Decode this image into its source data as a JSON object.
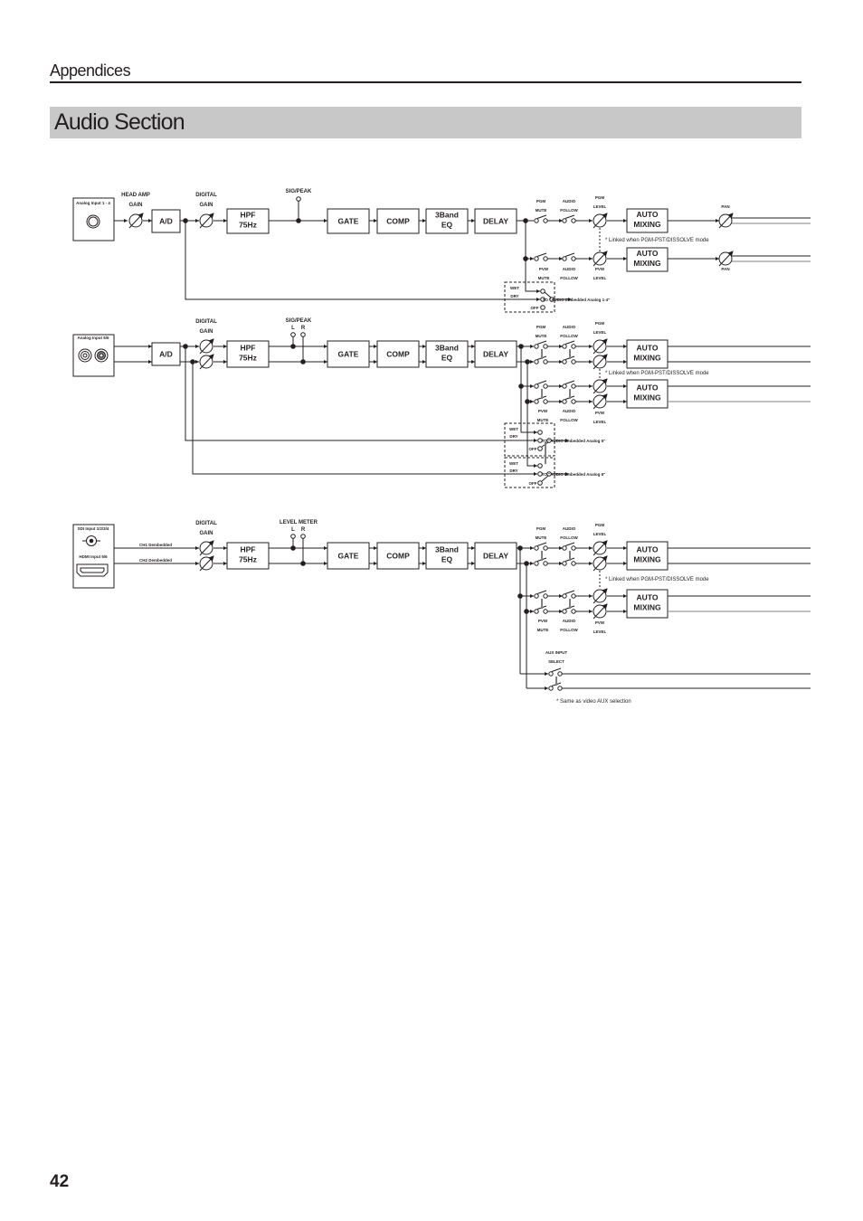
{
  "header": {
    "section": "Appendices",
    "title": "Audio Section"
  },
  "page_number": "42",
  "colors": {
    "ink": "#231f20",
    "title_bar": "#c8c8c8",
    "secondary_line": "#808080"
  },
  "labels": {
    "head_amp_gain": [
      "HEAD AMP",
      "GAIN"
    ],
    "digital_gain": [
      "DIGITAL",
      "GAIN"
    ],
    "sig_peak": "SIG/PEAK",
    "level_meter": "LEVEL METER",
    "l": "L",
    "r": "R",
    "pgm_mute": [
      "PGM",
      "MUTE"
    ],
    "pvw_mute": [
      "PVW",
      "MUTE"
    ],
    "audio_follow": [
      "AUDIO",
      "FOLLOW"
    ],
    "pgm_level": [
      "PGM",
      "LEVEL"
    ],
    "pvw_level": [
      "PVW",
      "LEVEL"
    ],
    "pan": "PAN",
    "wet": "WET",
    "dry": "DRY",
    "off": "OFF",
    "aux_input_select": [
      "AUX INPUT",
      "SELECT"
    ],
    "ch1": "CH1 Dembedded",
    "ch2": "CH2 Dembedded"
  },
  "blocks": {
    "ad": "A/D",
    "hpf": [
      "HPF",
      "75Hz"
    ],
    "gate": "GATE",
    "comp": "COMP",
    "eq": [
      "3Band",
      "EQ"
    ],
    "delay": "DELAY",
    "auto_mixing": [
      "AUTO",
      "MIXING"
    ]
  },
  "inputs": {
    "analog_1_4": "Analog Input 1 - 4",
    "analog_5_6": "Analog Input 5/6",
    "sdi": "SDI Input 1/2/3/4",
    "hdmi": "HDMI Input 5/6"
  },
  "notes": {
    "linked": "* Linked when PGM-PST/DISSOLVE mode",
    "aux_same": "* Same as video AUX selection"
  },
  "outputs": {
    "embedded_1_4": "TO \"AUDIO Embedded Analog 1-4\"",
    "embedded_5": "TO \"AUDIO Embedded Analog 5\"",
    "embedded_6": "TO \"AUDIO Embedded Analog 6\""
  }
}
